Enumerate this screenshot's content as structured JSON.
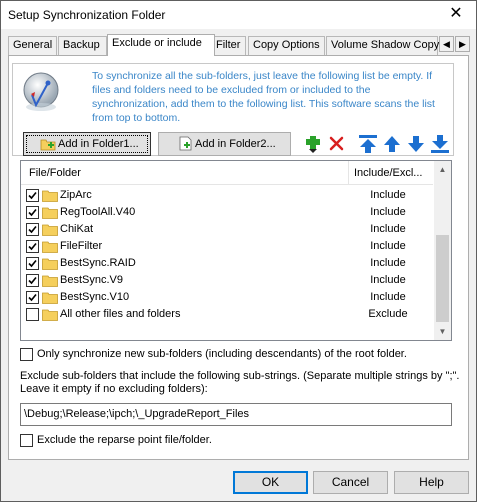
{
  "window": {
    "title": "Setup Synchronization Folder",
    "close_glyph": "✕"
  },
  "tabs": [
    {
      "label": "General"
    },
    {
      "label": "Backup"
    },
    {
      "label": "Exclude or include"
    },
    {
      "label": "Filter"
    },
    {
      "label": "Copy Options"
    },
    {
      "label": "Volume Shadow Copy"
    }
  ],
  "tab_scroll": {
    "left": "◀",
    "right": "▶"
  },
  "info_text": "To synchronize all the sub-folders, just leave the following list be empty. If files and folders need to be excluded from or included to the synchronization, add them to the following list. This software scans the list from top to bottom.",
  "toolbar": {
    "add_folder1": "Add in Folder1...",
    "add_folder2": "Add in Folder2...",
    "icons": [
      "add-icon",
      "delete-icon",
      "move-top-icon",
      "move-up-icon",
      "move-down-icon",
      "move-bottom-icon"
    ]
  },
  "list": {
    "headers": {
      "name": "File/Folder",
      "mode": "Include/Excl..."
    },
    "rows": [
      {
        "name": "ZipArc",
        "mode": "Include",
        "checked": true
      },
      {
        "name": "RegToolAll.V40",
        "mode": "Include",
        "checked": true
      },
      {
        "name": "ChiKat",
        "mode": "Include",
        "checked": true
      },
      {
        "name": "FileFilter",
        "mode": "Include",
        "checked": true
      },
      {
        "name": "BestSync.RAID",
        "mode": "Include",
        "checked": true
      },
      {
        "name": "BestSync.V9",
        "mode": "Include",
        "checked": true
      },
      {
        "name": "BestSync.V10",
        "mode": "Include",
        "checked": true
      },
      {
        "name": "All other files and folders",
        "mode": "Exclude",
        "checked": false
      }
    ]
  },
  "only_new_subfolders": {
    "label": "Only synchronize new sub-folders (including descendants) of the root folder.",
    "checked": false
  },
  "exclude_help": "Exclude sub-folders that include the following sub-strings. (Separate multiple strings by \";\". Leave it empty if no excluding folders):",
  "exclude_value": "\\Debug;\\Release;\\ipch;\\_UpgradeReport_Files",
  "reparse": {
    "label": "Exclude the reparse point file/folder.",
    "checked": false
  },
  "buttons": {
    "ok": "OK",
    "cancel": "Cancel",
    "help": "Help"
  },
  "colors": {
    "info_text": "#3a86c8",
    "arrow_blue": "#1c6fd0",
    "add_green": "#2aa22a",
    "delete_red": "#d81e1e",
    "folder_yellow": "#f5cf5c"
  }
}
